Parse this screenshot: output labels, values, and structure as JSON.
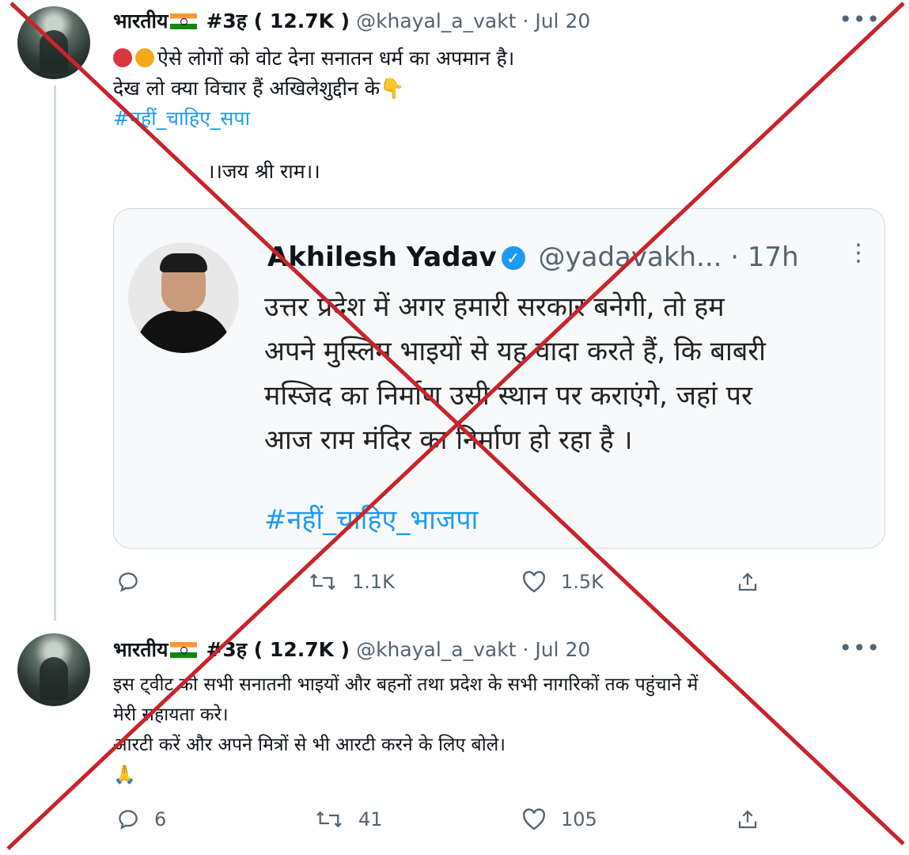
{
  "tweet1": {
    "display_name": "भारतीय",
    "name_suffix": "#3ह ( 12.7K )",
    "handle": "@khayal_a_vakt",
    "date": "· Jul 20",
    "lines": [
      "ऐसे लोगों को वोट देना  सनातन धर्म का अपमान है।",
      "देख लो क्या विचार हैं  अखिलेशुद्दीन के"
    ],
    "hashtag": "#नहीं_चाहिए_सपा",
    "footer_line": "।।जय श्री राम।।",
    "reply_count": "",
    "retweet_count": "1.1K",
    "like_count": "1.5K"
  },
  "quoted": {
    "display_name": "Akhilesh Yadav",
    "handle": "@yadavakh...",
    "time": "· 17h",
    "lines": [
      "उत्तर प्रदेश में अगर हमारी सरकार बनेगी, तो हम",
      "अपने मुस्लिम भाइयों से यह वादा करते हैं, कि बाबरी",
      "मस्जिद का निर्माण उसी स्थान पर कराएंगे, जहां पर",
      "आज राम मंदिर का निर्माण हो रहा है ।"
    ],
    "hashtag": "#नहीं_चाहिए_भाजपा"
  },
  "tweet2": {
    "display_name": "भारतीय",
    "name_suffix": "#3ह ( 12.7K )",
    "handle": "@khayal_a_vakt",
    "date": "· Jul 20",
    "lines": [
      "इस ट्वीट को सभी सनातनी भाइयों और बहनों तथा प्रदेश के सभी नागरिकों तक पहुंचाने में",
      "मेरी सहायता करे।",
      "आरटी करें और अपने मित्रों से भी आरटी करने के लिए बोले।"
    ],
    "reply_count": "6",
    "retweet_count": "41",
    "like_count": "105"
  },
  "colors": {
    "accent": "#1d9bf0",
    "muted": "#536471",
    "cross": "#c8242b"
  },
  "icons": {
    "reply": "reply-icon",
    "retweet": "retweet-icon",
    "like": "heart-icon",
    "share": "share-icon",
    "more": "more-dots-icon",
    "verified": "verified-badge-icon"
  }
}
